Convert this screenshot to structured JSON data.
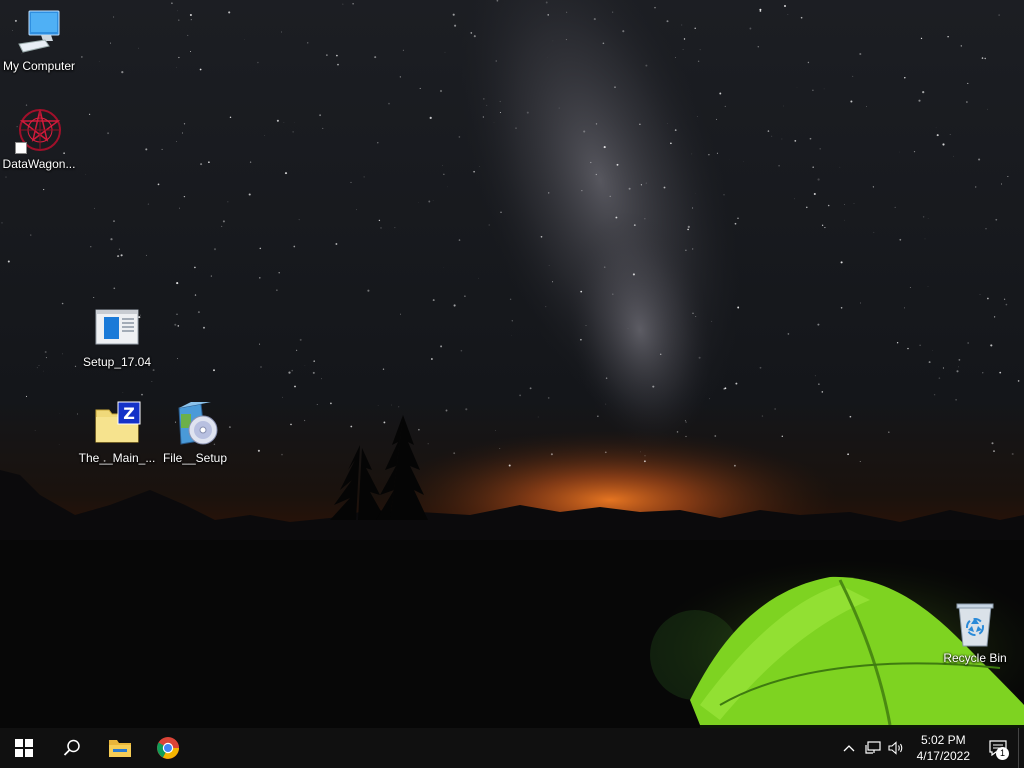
{
  "desktop": {
    "icons": [
      {
        "label": "My Computer",
        "icon": "computer-icon"
      },
      {
        "label": "DataWagon...",
        "icon": "datawagon-icon"
      },
      {
        "label": "Setup_17.04",
        "icon": "setup-window-icon"
      },
      {
        "label": "The__Main_...",
        "icon": "zip-folder-icon"
      },
      {
        "label": "File__Setup",
        "icon": "installer-cd-icon"
      },
      {
        "label": "Recycle Bin",
        "icon": "recycle-bin-icon"
      }
    ]
  },
  "taskbar": {
    "buttons": [
      "windows-start-icon",
      "search-icon",
      "file-explorer-icon",
      "chrome-icon"
    ],
    "tray": {
      "icons": [
        "chevron-up-icon",
        "network-icon",
        "volume-icon"
      ],
      "time": "5:02 PM",
      "date": "4/17/2022",
      "notification_count": "1"
    }
  },
  "colors": {
    "taskbar": "#101010",
    "tent": "#7ed321",
    "horizon_glow": "#e8661a",
    "sky": "#1b1e24"
  }
}
